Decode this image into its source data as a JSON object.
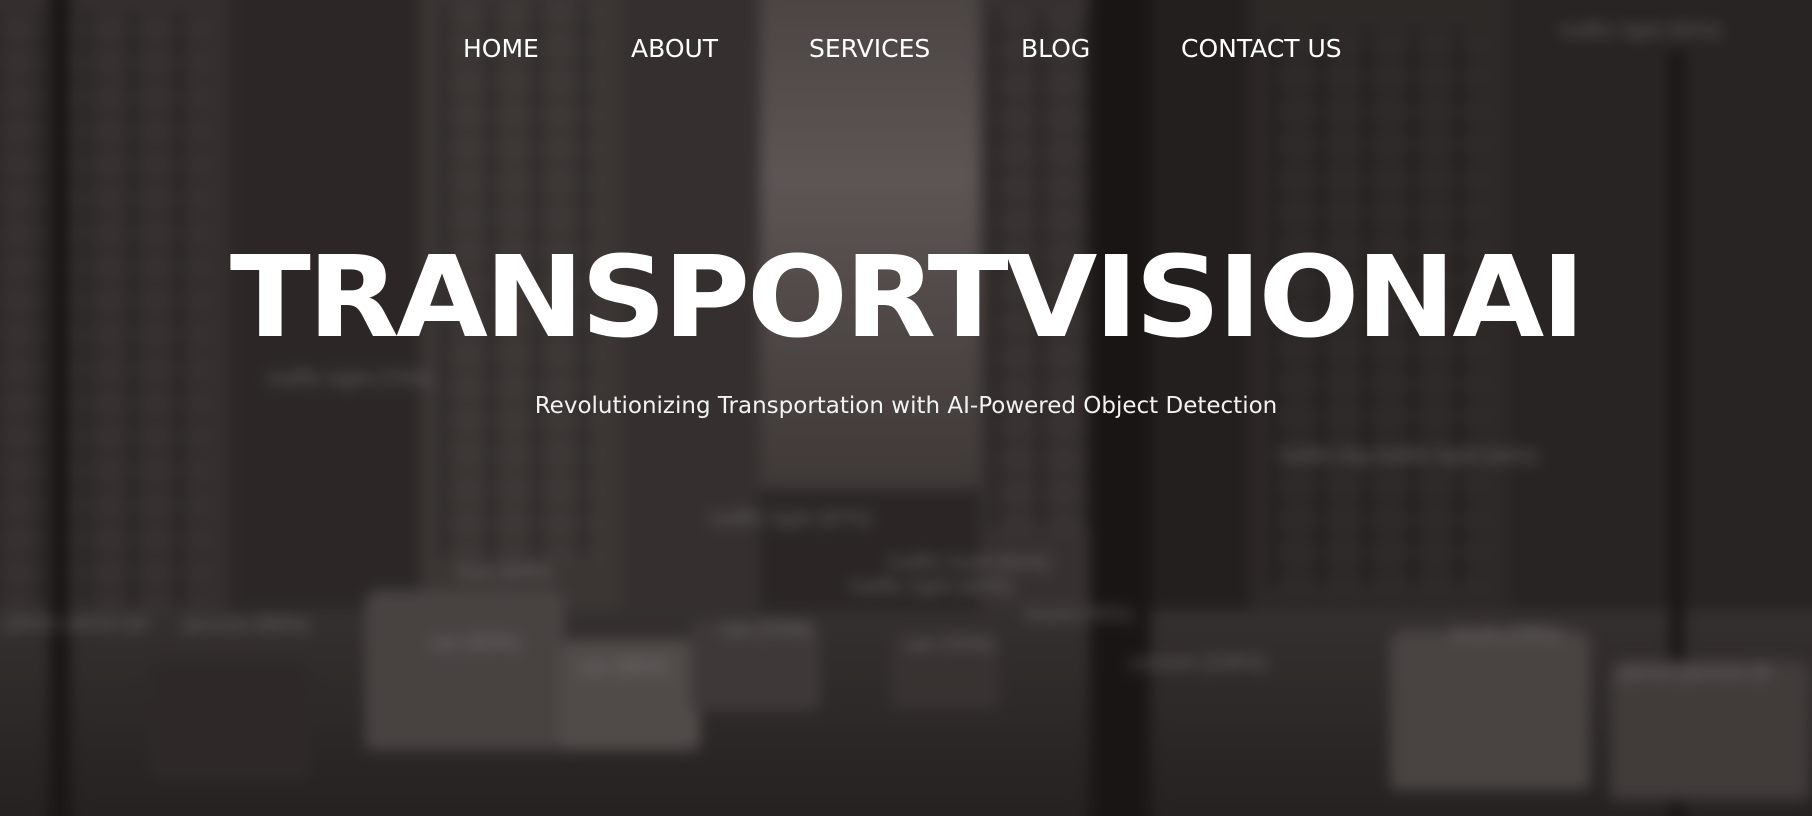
{
  "nav": {
    "items": [
      {
        "label": "HOME"
      },
      {
        "label": "ABOUT"
      },
      {
        "label": "SERVICES"
      },
      {
        "label": "BLOG"
      },
      {
        "label": "CONTACT US"
      }
    ]
  },
  "hero": {
    "title": "TRANSPORTVISIONAI",
    "subtitle": "Revolutionizing Transportation with AI-Powered Object Detection"
  },
  "background": {
    "detection_labels": [
      "traffic light (93%)",
      "traffic light (73%)",
      "traffic light (97%)",
      "traffic big traffic light (84%)",
      "traffic hold (81%)",
      "traffic light (82%)",
      "truck (78%)",
      "bus (84%)",
      "perso perso pe",
      "person (90%)",
      "car (92%)",
      "car (71%)",
      "car (99%)",
      "car (72%)",
      "person (100%)",
      "truck (78%)",
      "perso person (9"
    ]
  },
  "colors": {
    "nav_text": "#ffffff",
    "title_text": "#ffffff",
    "overlay": "#120e0c"
  }
}
